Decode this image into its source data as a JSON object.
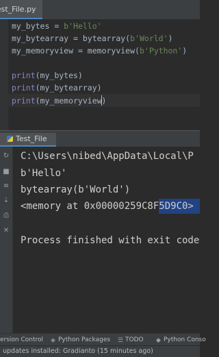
{
  "editor": {
    "tab_label": "Test_File.py",
    "lines": {
      "l1_var": "my_bytes",
      "l1_op": " = ",
      "l1_val": "b'Hello'",
      "l2_var": "my_bytearray",
      "l2_op": " = ",
      "l2_fn": "bytearray(",
      "l2_arg": "b'World'",
      "l2_end": ")",
      "l3_var": "my_memoryview",
      "l3_op": " = ",
      "l3_fn": "memoryview(",
      "l3_arg": "b'Python'",
      "l3_end": ")",
      "l5_fn": "print",
      "l5_arg": "(my_bytes)",
      "l6_fn": "print",
      "l6_arg": "(my_bytearray)",
      "l7_fn": "print",
      "l7_arg": "(my_memoryview)"
    }
  },
  "run": {
    "tab_label": "Test_File",
    "output": [
      "C:\\Users\\nibed\\AppData\\Local\\P",
      "b'Hello'",
      "bytearray(b'World')",
      "<memory at 0x00000259C8F5D9C0>",
      "",
      "Process finished with exit code"
    ]
  },
  "bottom_bar": {
    "version_control": "ersion Control",
    "python_packages": "Python Packages",
    "todo": "TODO",
    "python_console": "Python Conso"
  },
  "status": {
    "message": "updates installed: Gradianto (15 minutes ago)"
  }
}
